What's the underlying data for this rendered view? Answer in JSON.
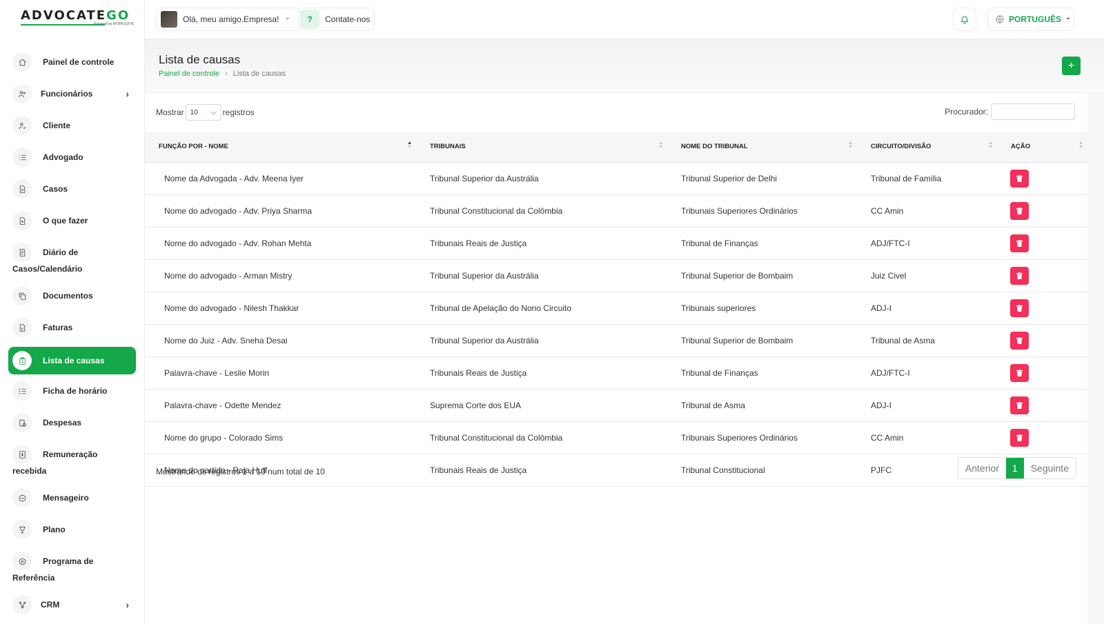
{
  "logo": {
    "text_main": "ADVOCATE",
    "text_accent": "GO",
    "sub": "Powered by WORKSUITE"
  },
  "sidebar": {
    "items": [
      {
        "label": "Painel de controle",
        "icon": "home-icon"
      },
      {
        "label": "Funcionários",
        "icon": "users-icon",
        "chevron": "›"
      },
      {
        "label": "Cliente",
        "icon": "user-check-icon"
      },
      {
        "label": "Advogado",
        "icon": "list-icon"
      },
      {
        "label": "Casos",
        "icon": "file-icon"
      },
      {
        "label": "O que fazer",
        "icon": "file-plus-icon"
      },
      {
        "label1": "Diário de",
        "label2": "Casos/Calendário",
        "icon": "diary-icon"
      },
      {
        "label": "Documentos",
        "icon": "copy-icon"
      },
      {
        "label": "Faturas",
        "icon": "invoice-icon"
      },
      {
        "label": "Lista de causas",
        "icon": "clipboard-icon"
      },
      {
        "label": "Ficha de horário",
        "icon": "checklist-icon"
      },
      {
        "label": "Despesas",
        "icon": "expense-icon"
      },
      {
        "label1": "Remuneração",
        "label2": "recebida",
        "icon": "money-icon"
      },
      {
        "label": "Mensageiro",
        "icon": "chat-icon"
      },
      {
        "label": "Plano",
        "icon": "trophy-icon"
      },
      {
        "label1": "Programa de",
        "label2": "Referência",
        "icon": "referral-icon"
      },
      {
        "label": "CRM",
        "icon": "crm-icon",
        "chevron": "›"
      }
    ]
  },
  "topbar": {
    "greeting": "Olá, meu amigo.Empresa!",
    "contact": "Contate-nos",
    "language": "PORTUGUÊS",
    "caret": "⌄"
  },
  "page": {
    "title": "Lista de causas",
    "breadcrumb": {
      "root": "Painel de controle",
      "current": "Lista de causas"
    },
    "add_label": "+"
  },
  "controls": {
    "show_label": "Mostrar",
    "show_value": "10",
    "records_label": "registros",
    "search_label": "Procurador:"
  },
  "table": {
    "headers": [
      "FUNÇÃO POR - NOME",
      "TRIBUNAIS",
      "NOME DO TRIBUNAL",
      "CIRCUITO/DIVISÃO",
      "AÇÃO"
    ],
    "rows": [
      [
        "Nome da Advogada - Adv. Meena Iyer",
        "Tribunal Superior da Austrália",
        "Tribunal Superior de Delhi",
        "Tribunal de Família"
      ],
      [
        "Nome do advogado - Adv. Priya Sharma",
        "Tribunal Constitucional da Colômbia",
        "Tribunais Superiores Ordinários",
        "CC Amin"
      ],
      [
        "Nome do advogado - Adv. Rohan Mehta",
        "Tribunais Reais de Justiça",
        "Tribunal de Finanças",
        "ADJ/FTC-I"
      ],
      [
        "Nome do advogado - Arman Mistry",
        "Tribunal Superior da Austrália",
        "Tribunal Superior de Bombaim",
        "Juiz Civel"
      ],
      [
        "Nome do advogado - Nilesh Thakkar",
        "Tribunal de Apelação do Nono Circuito",
        "Tribunais superiores",
        "ADJ-I"
      ],
      [
        "Nome do Juiz - Adv. Sneha Desai",
        "Tribunal Superior da Austrália",
        "Tribunal Superior de Bombaim",
        "Tribunal de Asma"
      ],
      [
        "Palavra-chave - Leslie Morin",
        "Tribunais Reais de Justiça",
        "Tribunal de Finanças",
        "ADJ/FTC-I"
      ],
      [
        "Palavra-chave - Odette Mendez",
        "Suprema Corte dos EUA",
        "Tribunal de Asma",
        "ADJ-I"
      ],
      [
        "Nome do grupo - Colorado Sims",
        "Tribunal Constitucional da Colômbia",
        "Tribunais Superiores Ordinários",
        "CC Amin"
      ],
      [
        "Nome do partido - Raja Huff",
        "Tribunais Reais de Justiça",
        "Tribunal Constitucional",
        "PJFC"
      ]
    ]
  },
  "footer": {
    "info": "Mostrando os registros 1 a 10 num total de 10",
    "prev": "Anterior",
    "page": "1",
    "next": "Seguinte"
  },
  "colors": {
    "accent": "#14a84b",
    "danger": "#f2305a"
  }
}
